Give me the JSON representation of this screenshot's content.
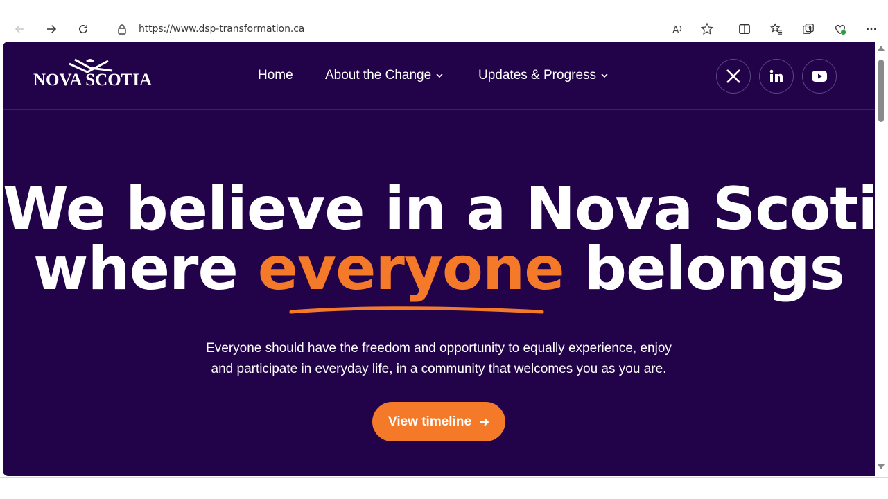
{
  "browser": {
    "url": "https://www.dsp-transformation.ca",
    "icons": [
      "back-icon",
      "forward-icon",
      "refresh-icon",
      "lock-icon",
      "read-aloud-icon",
      "favorite-star-icon",
      "split-screen-icon",
      "favorites-icon",
      "collections-icon",
      "extension-icon",
      "more-icon"
    ]
  },
  "site": {
    "logo_text": "NOVA SCOTIA",
    "nav": [
      {
        "label": "Home"
      },
      {
        "label": "About the Change"
      },
      {
        "label": "Updates & Progress"
      }
    ],
    "social": [
      "x-icon",
      "linkedin-icon",
      "youtube-icon"
    ]
  },
  "hero": {
    "line1": "We believe in a Nova Scotia",
    "line2_before": "where ",
    "line2_accent": "everyone",
    "line2_after": " belongs",
    "sub1": "Everyone should have the freedom and opportunity to equally experience, enjoy",
    "sub2": "and participate in everyday life, in a community that welcomes you as you are.",
    "cta_label": "View timeline"
  },
  "colors": {
    "background": "#22034a",
    "accent": "#f47a2a",
    "text": "#ffffff"
  }
}
